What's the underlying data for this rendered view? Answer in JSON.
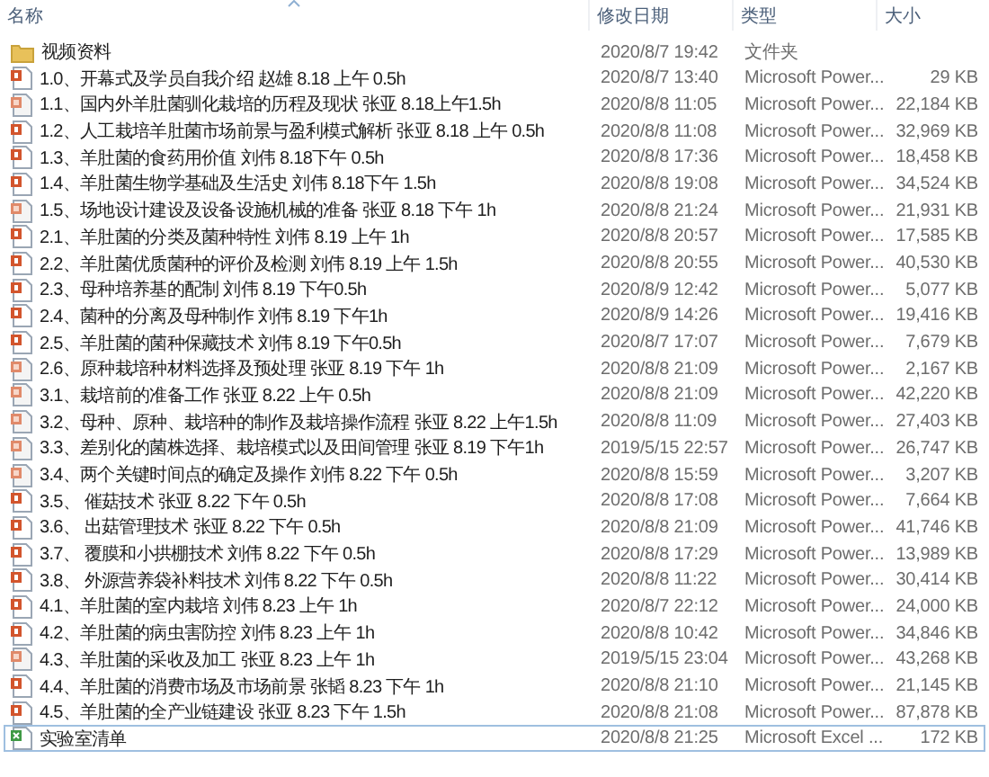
{
  "columns": [
    {
      "label": "名称"
    },
    {
      "label": "修改日期"
    },
    {
      "label": "类型"
    },
    {
      "label": "大小"
    }
  ],
  "files": [
    {
      "kind": "folder",
      "name": "视频资料",
      "modified": "2020/8/7 19:42",
      "type": "文件夹",
      "focused": false
    },
    {
      "kind": "pptx",
      "name": "1.0、开幕式及学员自我介绍 赵雄 8.18 上午 0.5h",
      "modified": "2020/8/7 13:40",
      "type": "Microsoft Power...",
      "size": "29 KB",
      "focused": false
    },
    {
      "kind": "ppt",
      "name": "1.1、国内外羊肚菌驯化栽培的历程及现状 张亚 8.18上午1.5h",
      "modified": "2020/8/8 11:05",
      "type": "Microsoft Power...",
      "size": "22,184 KB",
      "focused": false
    },
    {
      "kind": "pptx",
      "name": "1.2、人工栽培羊肚菌市场前景与盈利模式解析  张亚 8.18 上午 0.5h",
      "modified": "2020/8/8 11:08",
      "type": "Microsoft Power...",
      "size": "32,969 KB",
      "focused": false
    },
    {
      "kind": "pptx",
      "name": "1.3、羊肚菌的食药用价值 刘伟 8.18下午 0.5h",
      "modified": "2020/8/8 17:36",
      "type": "Microsoft Power...",
      "size": "18,458 KB",
      "focused": false
    },
    {
      "kind": "pptx",
      "name": "1.4、羊肚菌生物学基础及生活史 刘伟 8.18下午 1.5h",
      "modified": "2020/8/8 19:08",
      "type": "Microsoft Power...",
      "size": "34,524 KB",
      "focused": false
    },
    {
      "kind": "ppt",
      "name": "1.5、场地设计建设及设备设施机械的准备  张亚 8.18 下午 1h",
      "modified": "2020/8/8 21:24",
      "type": "Microsoft Power...",
      "size": "21,931 KB",
      "focused": false
    },
    {
      "kind": "pptx",
      "name": "2.1、羊肚菌的分类及菌种特性 刘伟 8.19 上午 1h",
      "modified": "2020/8/8 20:57",
      "type": "Microsoft Power...",
      "size": "17,585 KB",
      "focused": false
    },
    {
      "kind": "pptx",
      "name": "2.2、羊肚菌优质菌种的评价及检测 刘伟 8.19 上午 1.5h",
      "modified": "2020/8/8 20:55",
      "type": "Microsoft Power...",
      "size": "40,530 KB",
      "focused": false
    },
    {
      "kind": "pptx",
      "name": "2.3、母种培养基的配制 刘伟 8.19 下午0.5h",
      "modified": "2020/8/9 12:42",
      "type": "Microsoft Power...",
      "size": "5,077 KB",
      "focused": false
    },
    {
      "kind": "pptx",
      "name": "2.4、菌种的分离及母种制作 刘伟 8.19 下午1h",
      "modified": "2020/8/9 14:26",
      "type": "Microsoft Power...",
      "size": "19,416 KB",
      "focused": false
    },
    {
      "kind": "pptx",
      "name": "2.5、羊肚菌的菌种保藏技术 刘伟 8.19 下午0.5h",
      "modified": "2020/8/7 17:07",
      "type": "Microsoft Power...",
      "size": "7,679 KB",
      "focused": false
    },
    {
      "kind": "ppt",
      "name": "2.6、原种栽培种材料选择及预处理  张亚 8.19 下午 1h",
      "modified": "2020/8/8 21:09",
      "type": "Microsoft Power...",
      "size": "2,167 KB",
      "focused": false
    },
    {
      "kind": "ppt",
      "name": "3.1、栽培前的准备工作  张亚 8.22 上午 0.5h",
      "modified": "2020/8/8 21:09",
      "type": "Microsoft Power...",
      "size": "42,220 KB",
      "focused": false
    },
    {
      "kind": "ppt",
      "name": "3.2、母种、原种、栽培种的制作及栽培操作流程 张亚 8.22 上午1.5h",
      "modified": "2020/8/8 11:09",
      "type": "Microsoft Power...",
      "size": "27,403 KB",
      "focused": false
    },
    {
      "kind": "ppt",
      "name": "3.3、差别化的菌株选择、栽培模式以及田间管理   张亚 8.19 下午1h",
      "modified": "2019/5/15 22:57",
      "type": "Microsoft Power...",
      "size": "26,747 KB",
      "focused": false
    },
    {
      "kind": "ppt",
      "name": "3.4、两个关键时间点的确定及操作  刘伟 8.22 下午 0.5h",
      "modified": "2020/8/8 15:59",
      "type": "Microsoft Power...",
      "size": "3,207 KB",
      "focused": false
    },
    {
      "kind": "pptx",
      "name": "3.5、 催菇技术  张亚 8.22 下午 0.5h",
      "modified": "2020/8/8 17:08",
      "type": "Microsoft Power...",
      "size": "7,664 KB",
      "focused": false
    },
    {
      "kind": "pptx",
      "name": "3.6、 出菇管理技术  张亚 8.22 下午 0.5h",
      "modified": "2020/8/8 21:09",
      "type": "Microsoft Power...",
      "size": "41,746 KB",
      "focused": false
    },
    {
      "kind": "pptx",
      "name": "3.7、 覆膜和小拱棚技术  刘伟 8.22 下午 0.5h",
      "modified": "2020/8/8 17:29",
      "type": "Microsoft Power...",
      "size": "13,989 KB",
      "focused": false
    },
    {
      "kind": "pptx",
      "name": "3.8、 外源营养袋补料技术  刘伟 8.22 下午 0.5h",
      "modified": "2020/8/8 11:22",
      "type": "Microsoft Power...",
      "size": "30,414 KB",
      "focused": false
    },
    {
      "kind": "pptx",
      "name": "4.1、羊肚菌的室内栽培 刘伟 8.23 上午 1h",
      "modified": "2020/8/7 22:12",
      "type": "Microsoft Power...",
      "size": "24,000 KB",
      "focused": false
    },
    {
      "kind": "pptx",
      "name": "4.2、羊肚菌的病虫害防控  刘伟 8.23 上午 1h",
      "modified": "2020/8/8 10:42",
      "type": "Microsoft Power...",
      "size": "34,846 KB",
      "focused": false
    },
    {
      "kind": "ppt",
      "name": "4.3、羊肚菌的采收及加工  张亚 8.23 上午 1h",
      "modified": "2019/5/15 23:04",
      "type": "Microsoft Power...",
      "size": "43,268 KB",
      "focused": false
    },
    {
      "kind": "pptx",
      "name": "4.4、羊肚菌的消费市场及市场前景 张韬 8.23 下午 1h",
      "modified": "2020/8/8 21:10",
      "type": "Microsoft Power...",
      "size": "21,145 KB",
      "focused": false
    },
    {
      "kind": "pptx",
      "name": "4.5、羊肚菌的全产业链建设 张亚 8.23 下午 1.5h",
      "modified": "2020/8/8 21:08",
      "type": "Microsoft Power...",
      "size": "87,878 KB",
      "focused": false
    },
    {
      "kind": "xls",
      "name": "实验室清单",
      "modified": "2020/8/8 21:25",
      "type": "Microsoft Excel ...",
      "size": "172 KB",
      "focused": true
    }
  ]
}
